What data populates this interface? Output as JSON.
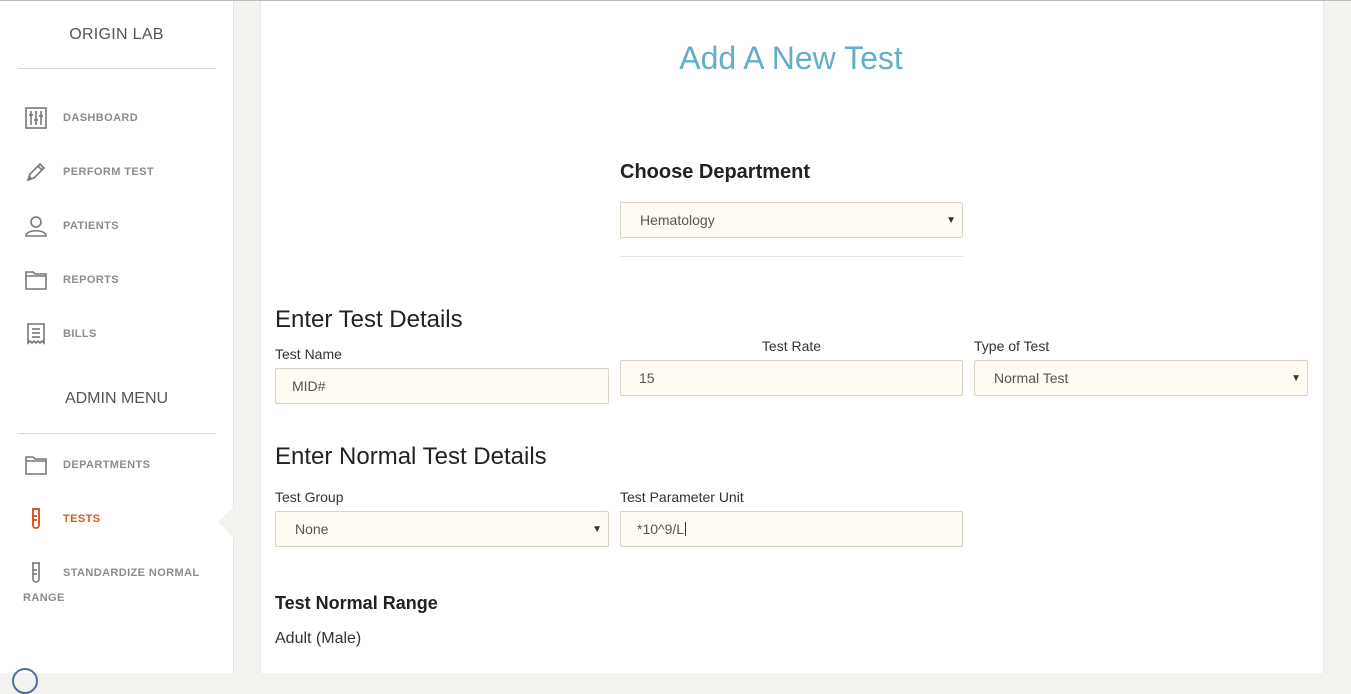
{
  "sidebar": {
    "brand": "ORIGIN LAB",
    "items": [
      {
        "label": "DASHBOARD",
        "icon": "sliders-icon"
      },
      {
        "label": "PERFORM TEST",
        "icon": "pen-icon"
      },
      {
        "label": "PATIENTS",
        "icon": "user-icon"
      },
      {
        "label": "REPORTS",
        "icon": "folder-icon"
      },
      {
        "label": "BILLS",
        "icon": "receipt-icon"
      }
    ],
    "admin_heading": "ADMIN MENU",
    "admin_items": [
      {
        "label": "DEPARTMENTS",
        "icon": "folder-icon"
      },
      {
        "label": "TESTS",
        "icon": "test-tube-icon",
        "active": true
      },
      {
        "label": "STANDARDIZE NORMAL",
        "label_line2": "RANGE",
        "icon": "test-tube-icon"
      }
    ]
  },
  "colors": {
    "accent_title": "#63aec9",
    "active_nav": "#d35a2a",
    "field_bg": "#fffaf2"
  },
  "page": {
    "title": "Add A New Test",
    "department": {
      "heading": "Choose Department",
      "selected": "Hematology"
    },
    "test_details": {
      "heading": "Enter Test Details",
      "name_label": "Test Name",
      "name_value": "MID#",
      "rate_label": "Test Rate",
      "rate_value": "15",
      "type_label": "Type of Test",
      "type_selected": "Normal Test"
    },
    "normal_details": {
      "heading": "Enter Normal Test Details",
      "group_label": "Test Group",
      "group_selected": "None",
      "unit_label": "Test Parameter Unit",
      "unit_value": "*10^9/L"
    },
    "normal_range": {
      "heading": "Test Normal Range",
      "subheading": "Adult (Male)"
    }
  }
}
